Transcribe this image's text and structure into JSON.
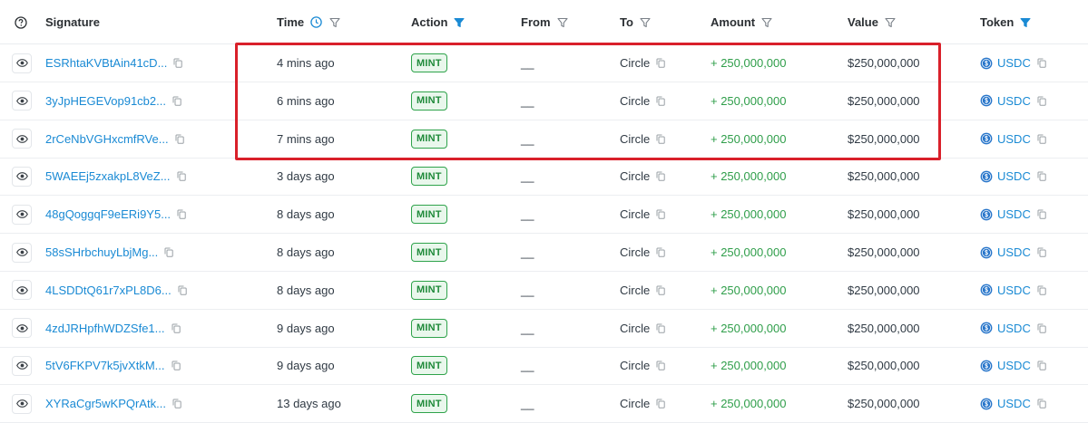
{
  "header": {
    "info_icon": "question-circle-icon",
    "signature": "Signature",
    "time": "Time",
    "action": "Action",
    "from": "From",
    "to": "To",
    "amount": "Amount",
    "value": "Value",
    "token": "Token"
  },
  "colors": {
    "link": "#1a8ad4",
    "amount_green": "#2f9e4a",
    "mint_border": "#2fa34b",
    "highlight_red": "#d9202a",
    "active_filter": "#1a8ad4"
  },
  "rows": [
    {
      "signature": "ESRhtaKVBtAin41cD...",
      "time": "4 mins ago",
      "action": "MINT",
      "from": "__",
      "to": "Circle",
      "amount": "+ 250,000,000",
      "value": "$250,000,000",
      "token": "USDC"
    },
    {
      "signature": "3yJpHEGEVop91cb2...",
      "time": "6 mins ago",
      "action": "MINT",
      "from": "__",
      "to": "Circle",
      "amount": "+ 250,000,000",
      "value": "$250,000,000",
      "token": "USDC"
    },
    {
      "signature": "2rCeNbVGHxcmfRVe...",
      "time": "7 mins ago",
      "action": "MINT",
      "from": "__",
      "to": "Circle",
      "amount": "+ 250,000,000",
      "value": "$250,000,000",
      "token": "USDC"
    },
    {
      "signature": "5WAEEj5zxakpL8VeZ...",
      "time": "3 days ago",
      "action": "MINT",
      "from": "__",
      "to": "Circle",
      "amount": "+ 250,000,000",
      "value": "$250,000,000",
      "token": "USDC"
    },
    {
      "signature": "48gQoggqF9eERi9Y5...",
      "time": "8 days ago",
      "action": "MINT",
      "from": "__",
      "to": "Circle",
      "amount": "+ 250,000,000",
      "value": "$250,000,000",
      "token": "USDC"
    },
    {
      "signature": "58sSHrbchuyLbjMg...",
      "time": "8 days ago",
      "action": "MINT",
      "from": "__",
      "to": "Circle",
      "amount": "+ 250,000,000",
      "value": "$250,000,000",
      "token": "USDC"
    },
    {
      "signature": "4LSDDtQ61r7xPL8D6...",
      "time": "8 days ago",
      "action": "MINT",
      "from": "__",
      "to": "Circle",
      "amount": "+ 250,000,000",
      "value": "$250,000,000",
      "token": "USDC"
    },
    {
      "signature": "4zdJRHpfhWDZSfe1...",
      "time": "9 days ago",
      "action": "MINT",
      "from": "__",
      "to": "Circle",
      "amount": "+ 250,000,000",
      "value": "$250,000,000",
      "token": "USDC"
    },
    {
      "signature": "5tV6FKPV7k5jvXtkM...",
      "time": "9 days ago",
      "action": "MINT",
      "from": "__",
      "to": "Circle",
      "amount": "+ 250,000,000",
      "value": "$250,000,000",
      "token": "USDC"
    },
    {
      "signature": "XYRaCgr5wKPQrAtk...",
      "time": "13 days ago",
      "action": "MINT",
      "from": "__",
      "to": "Circle",
      "amount": "+ 250,000,000",
      "value": "$250,000,000",
      "token": "USDC"
    }
  ]
}
